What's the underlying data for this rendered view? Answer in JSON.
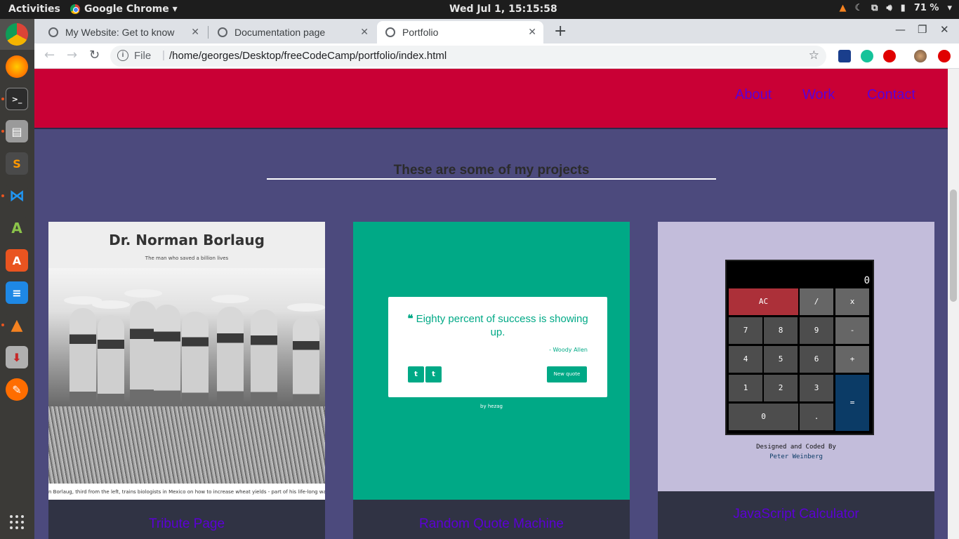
{
  "topbar": {
    "activities": "Activities",
    "app_name": "Google Chrome ▾",
    "clock": "Wed Jul  1, 15:15:58",
    "battery": "71 %"
  },
  "dock": {
    "items": [
      "chrome-icon",
      "firefox-icon",
      "terminal-icon",
      "files-icon",
      "sublime-icon",
      "vscode-icon",
      "android-studio-icon",
      "software-center-icon",
      "writer-icon",
      "vlc-icon",
      "installer-icon",
      "inkscape-icon"
    ]
  },
  "tabs": [
    {
      "title": "My Website: Get to know"
    },
    {
      "title": "Documentation page"
    },
    {
      "title": "Portfolio"
    }
  ],
  "omnibox": {
    "file_label": "File",
    "url": "/home/georges/Desktop/freeCodeCamp/portfolio/index.html"
  },
  "page": {
    "nav": [
      "About",
      "Work",
      "Contact"
    ],
    "projects_title": "These are some of my projects",
    "cards": [
      {
        "label": "Tribute Page",
        "heading": "Dr. Norman Borlaug",
        "subheading": "The man who saved a billion lives",
        "caption": "n Borlaug, third from the left, trains biologists in Mexico on how to increase wheat yields - part of his life-long war o"
      },
      {
        "label": "Random Quote Machine",
        "quote": "Eighty percent of success is showing up.",
        "author": "- Woody Allen",
        "twitter": "t",
        "tumblr": "t",
        "new_quote": "New quote",
        "by": "by hezag"
      },
      {
        "label": "JavaScript Calculator",
        "display": "0",
        "keys": [
          "AC",
          "/",
          "x",
          "7",
          "8",
          "9",
          "-",
          "4",
          "5",
          "6",
          "+",
          "1",
          "2",
          "3",
          "=",
          "0",
          "."
        ],
        "credit": "Designed and Coded By",
        "credit_author": "Peter Weinberg"
      }
    ]
  },
  "colors": {
    "navbar": "#c90035",
    "page_bg": "#4c4a7d",
    "link": "#5c00d6",
    "quote_green": "#00a986",
    "calc_bg": "#c3bddb"
  }
}
